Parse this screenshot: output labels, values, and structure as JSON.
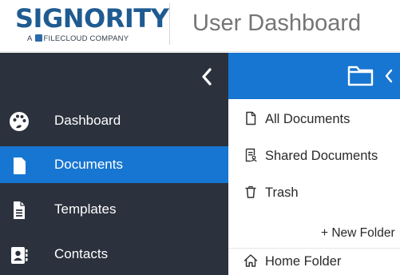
{
  "brand": {
    "logo_text": "SIGNORITY",
    "logo_tagline_prefix": "A",
    "logo_tagline_brand": "FILECLOUD COMPANY",
    "page_title": "User Dashboard",
    "colors": {
      "logo_blue": "#1f5b91",
      "sidebar_bg": "#2b323d",
      "accent_blue": "#1776d1"
    }
  },
  "sidebar": {
    "collapse_icon": "chevron-left-icon",
    "items": [
      {
        "label": "Dashboard",
        "icon": "palette-icon",
        "active": false
      },
      {
        "label": "Documents",
        "icon": "document-icon",
        "active": true
      },
      {
        "label": "Templates",
        "icon": "template-icon",
        "active": false
      },
      {
        "label": "Contacts",
        "icon": "contact-book-icon",
        "active": false
      }
    ]
  },
  "folders": {
    "header_icon": "folder-icon",
    "collapse_icon": "chevron-left-icon",
    "items": [
      {
        "label": "All Documents",
        "icon": "file-outline-icon"
      },
      {
        "label": "Shared Documents",
        "icon": "shared-document-icon"
      },
      {
        "label": "Trash",
        "icon": "trash-icon"
      }
    ],
    "new_folder_label": "+ New Folder",
    "home_folder_label": "Home Folder",
    "home_icon": "home-icon"
  }
}
